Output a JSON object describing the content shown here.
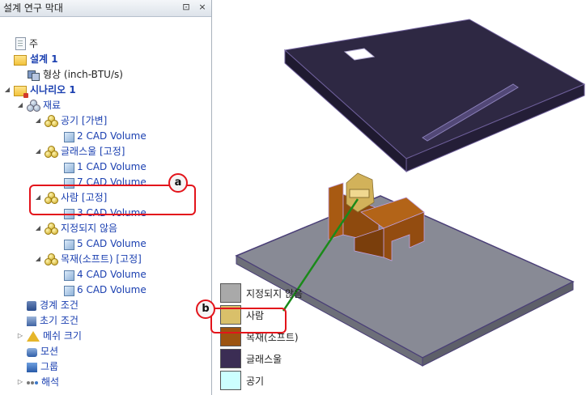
{
  "panel": {
    "title": "설계 연구 막대",
    "pin_glyph": "⊡",
    "close_glyph": "×"
  },
  "tree": [
    {
      "label": "주",
      "icon": "document-icon",
      "depth": 0,
      "expander": "",
      "style": "dark"
    },
    {
      "label": "설계 1",
      "icon": "design-folder-icon",
      "depth": 0,
      "expander": "",
      "style": "bold"
    },
    {
      "label": "형상 (inch-BTU/s)",
      "icon": "geometry-icon",
      "depth": 1,
      "expander": "",
      "style": "dark"
    },
    {
      "label": "시나리오 1",
      "icon": "scenario-icon",
      "depth": 0,
      "expander": "◢",
      "style": "bold"
    },
    {
      "label": "재료",
      "icon": "materials-icon",
      "depth": 1,
      "expander": "◢",
      "style": ""
    },
    {
      "label": "공기 [가변]",
      "icon": "material-icon",
      "depth": 2,
      "expander": "◢",
      "style": ""
    },
    {
      "label": "2 CAD Volume",
      "icon": "cad-volume-icon",
      "depth": 3,
      "expander": "",
      "style": ""
    },
    {
      "label": "글래스울 [고정]",
      "icon": "material-icon",
      "depth": 2,
      "expander": "◢",
      "style": ""
    },
    {
      "label": "1 CAD Volume",
      "icon": "cad-volume-icon",
      "depth": 3,
      "expander": "",
      "style": ""
    },
    {
      "label": "7 CAD Volume",
      "icon": "cad-volume-icon",
      "depth": 3,
      "expander": "",
      "style": ""
    },
    {
      "label": "사람 [고정]",
      "icon": "material-icon",
      "depth": 2,
      "expander": "◢",
      "style": ""
    },
    {
      "label": "3 CAD Volume",
      "icon": "cad-volume-icon",
      "depth": 3,
      "expander": "",
      "style": ""
    },
    {
      "label": "지정되지 않음",
      "icon": "material-icon",
      "depth": 2,
      "expander": "◢",
      "style": ""
    },
    {
      "label": "5 CAD Volume",
      "icon": "cad-volume-icon",
      "depth": 3,
      "expander": "",
      "style": ""
    },
    {
      "label": "목재(소프트) [고정]",
      "icon": "material-icon",
      "depth": 2,
      "expander": "◢",
      "style": ""
    },
    {
      "label": "4 CAD Volume",
      "icon": "cad-volume-icon",
      "depth": 3,
      "expander": "",
      "style": ""
    },
    {
      "label": "6 CAD Volume",
      "icon": "cad-volume-icon",
      "depth": 3,
      "expander": "",
      "style": ""
    },
    {
      "label": "경계 조건",
      "icon": "boundary-conditions-icon",
      "depth": 1,
      "expander": "",
      "style": ""
    },
    {
      "label": "초기 조건",
      "icon": "initial-conditions-icon",
      "depth": 1,
      "expander": "",
      "style": ""
    },
    {
      "label": "메쉬 크기",
      "icon": "mesh-size-icon",
      "depth": 1,
      "expander": "▷",
      "style": ""
    },
    {
      "label": "모션",
      "icon": "motion-icon",
      "depth": 1,
      "expander": "",
      "style": ""
    },
    {
      "label": "그룹",
      "icon": "groups-icon",
      "depth": 1,
      "expander": "",
      "style": ""
    },
    {
      "label": "해석",
      "icon": "solve-icon",
      "depth": 1,
      "expander": "▷",
      "style": ""
    }
  ],
  "callouts": {
    "a": "a",
    "b": "b"
  },
  "legend": [
    {
      "label": "지정되지 않음",
      "color": "#a9a9a9"
    },
    {
      "label": "사람",
      "color": "#d9c06a"
    },
    {
      "label": "목재(소프트)",
      "color": "#9c5410"
    },
    {
      "label": "글래스울",
      "color": "#3b2d54"
    },
    {
      "label": "공기",
      "color": "#ccffff"
    }
  ],
  "colors": {
    "callout": "#e3141b",
    "leader_line": "#1a8a1a",
    "link": "#1a3fb0"
  }
}
